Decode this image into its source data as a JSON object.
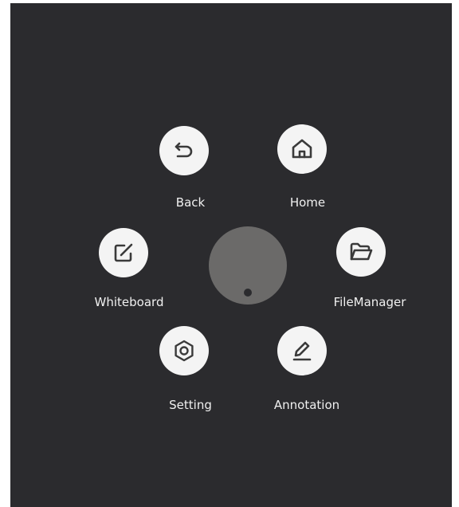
{
  "menu": {
    "items": [
      {
        "id": "back",
        "label": "Back",
        "icon": "back-arrow-icon"
      },
      {
        "id": "home",
        "label": "Home",
        "icon": "home-icon"
      },
      {
        "id": "whiteboard",
        "label": "Whiteboard",
        "icon": "edit-square-icon"
      },
      {
        "id": "filemanager",
        "label": "FileManager",
        "icon": "folder-icon"
      },
      {
        "id": "setting",
        "label": "Setting",
        "icon": "gear-icon"
      },
      {
        "id": "annotation",
        "label": "Annotation",
        "icon": "pen-icon"
      }
    ]
  },
  "colors": {
    "background": "#2b2b2e",
    "button": "#f4f4f4",
    "icon": "#3a3a3a",
    "label": "#f0f0f0",
    "knob": "#6b6a69"
  }
}
